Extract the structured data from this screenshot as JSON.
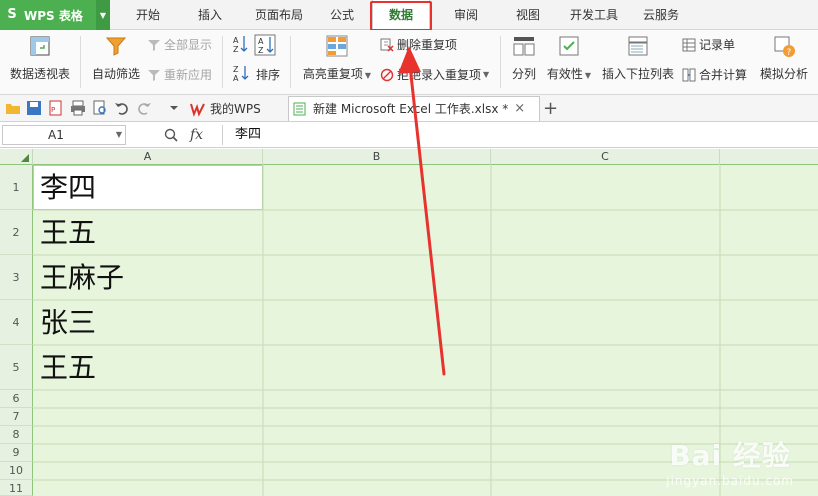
{
  "app": {
    "logo": "S",
    "title": "WPS 表格"
  },
  "menu": {
    "tabs": [
      {
        "label": "开始"
      },
      {
        "label": "插入"
      },
      {
        "label": "页面布局"
      },
      {
        "label": "公式"
      },
      {
        "label": "数据",
        "active": true
      },
      {
        "label": "审阅"
      },
      {
        "label": "视图"
      },
      {
        "label": "开发工具"
      },
      {
        "label": "云服务"
      }
    ]
  },
  "ribbon": {
    "pivot": "数据透视表",
    "autofilter": "自动筛选",
    "show_all": "全部显示",
    "reapply": "重新应用",
    "sort": "排序",
    "highlight_dup": "高亮重复项",
    "remove_dup": "删除重复项",
    "reject_dup": "拒绝录入重复项",
    "split": "分列",
    "validity": "有效性",
    "insert_dropdown": "插入下拉列表",
    "record_form": "记录单",
    "consolidate": "合并计算",
    "simulation": "模拟分析"
  },
  "doc_tabs": {
    "mywps": "我的WPS",
    "file": "新建 Microsoft Excel 工作表.xlsx *",
    "add": "+"
  },
  "formula_bar": {
    "name_box": "A1",
    "fx": "fx",
    "value": "李四"
  },
  "grid": {
    "columns": [
      "A",
      "B",
      "C"
    ],
    "rows": [
      "1",
      "2",
      "3",
      "4",
      "5",
      "6",
      "7",
      "8",
      "9",
      "10",
      "11"
    ],
    "cells_a": [
      "李四",
      "王五",
      "王麻子",
      "张三",
      "王五"
    ]
  },
  "watermark": {
    "main": "Bai 经验",
    "sub": "jingyan.baidu.com"
  },
  "colors": {
    "brand": "#4caf50",
    "active_tab_text": "#2e7d32",
    "highlight": "#e8322e",
    "grid_bg": "#e6f5dc"
  }
}
